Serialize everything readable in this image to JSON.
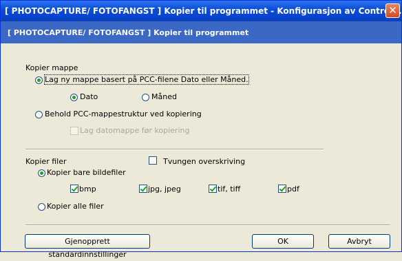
{
  "window": {
    "title": "[ PHOTOCAPTURE/ FOTOFANGST ]  Kopier til programmet - Konfigurasjon av ControlC...",
    "close_symbol": "✕"
  },
  "header": {
    "title": "[ PHOTOCAPTURE/ FOTOFANGST ]  Kopier til programmet"
  },
  "kopier_mappe": {
    "label": "Kopier mappe",
    "option_new_folder": {
      "label": "Lag ny mappe basert på PCC-filene Dato eller Måned.",
      "selected": true
    },
    "sub_dato": {
      "label": "Dato",
      "selected": true
    },
    "sub_maned": {
      "label": "Måned",
      "selected": false
    },
    "option_keep_structure": {
      "label": "Behold PCC-mappestruktur ved kopiering",
      "selected": false
    },
    "date_folder_check": {
      "label": "Lag datomappe før kopiering",
      "checked": false,
      "enabled": false
    }
  },
  "kopier_filer": {
    "label": "Kopier filer",
    "force_overwrite": {
      "label": "Tvungen overskriving",
      "checked": false
    },
    "option_images_only": {
      "label": "Kopier bare bildefiler",
      "selected": true
    },
    "types": [
      {
        "label": "bmp",
        "checked": true
      },
      {
        "label": "jpg, jpeg",
        "checked": true
      },
      {
        "label": "tif, tiff",
        "checked": true
      },
      {
        "label": "pdf",
        "checked": true
      }
    ],
    "option_all_files": {
      "label": "Kopier alle filer",
      "selected": false
    }
  },
  "buttons": {
    "restore_defaults": "Gjenopprett standardinnstillinger",
    "ok": "OK",
    "cancel": "Avbryt"
  }
}
